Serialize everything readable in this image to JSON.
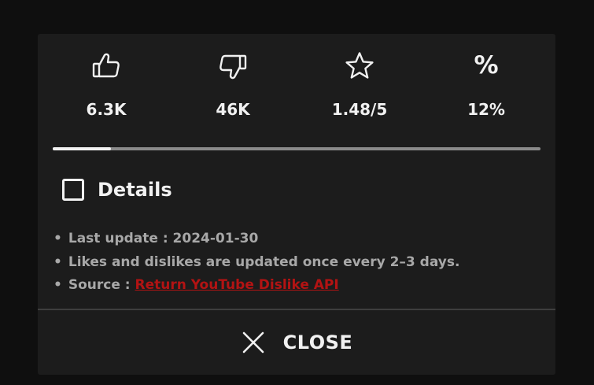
{
  "stats": {
    "likes": {
      "icon": "thumbs-up-icon",
      "value": "6.3K"
    },
    "dislikes": {
      "icon": "thumbs-down-icon",
      "value": "46K"
    },
    "rating": {
      "icon": "star-icon",
      "value": "1.48/5"
    },
    "percent": {
      "icon": "percent-icon",
      "glyph": "%",
      "value": "12%"
    }
  },
  "ratio_bar": {
    "like_fraction": 0.12,
    "fill_color": "#f1f1f1",
    "track_color": "#8a8a8a"
  },
  "details": {
    "label": "Details",
    "checked": false
  },
  "info": {
    "bullet": "•",
    "last_update": "Last update : 2024-01-30",
    "update_frequency": "Likes and dislikes are updated once every 2–3 days.",
    "source_prefix": "Source : ",
    "source_link": "Return YouTube Dislike API",
    "link_color": "#b31313"
  },
  "close": {
    "icon": "close-icon",
    "label": "CLOSE"
  }
}
